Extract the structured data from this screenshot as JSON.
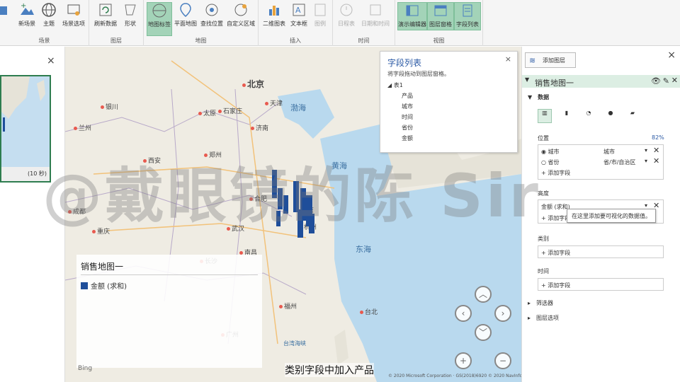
{
  "ribbon": {
    "groups": [
      {
        "label": "场景"
      },
      {
        "label": "图层"
      },
      {
        "label": "地图"
      },
      {
        "label": "插入"
      },
      {
        "label": "时间"
      },
      {
        "label": "视图"
      }
    ],
    "buttons": {
      "play": "播放\n演示",
      "new_scene": "新场景",
      "theme": "主题",
      "scene_options": "场景选项",
      "refresh": "刷新数据",
      "shapes": "形状",
      "map_labels": "地图标签",
      "flat_map": "平面地图",
      "find_location": "查找位置",
      "custom_region": "自定义区域",
      "chart_2d": "二维图表",
      "text_box": "文本框",
      "legend": "图例",
      "timeline": "日程表",
      "date_time": "日期和时间",
      "tour_editor": "演示编辑器",
      "layer_pane": "图层窗格",
      "field_list": "字段列表"
    }
  },
  "left_pane": {
    "close": "×",
    "thumb_duration": "(10 秒)"
  },
  "map": {
    "cities": [
      "北京",
      "天津",
      "太原",
      "石家庄",
      "济南",
      "郑州",
      "西安",
      "合肥",
      "成都",
      "重庆",
      "银川",
      "兰州",
      "长沙",
      "南昌",
      "福州",
      "杭州",
      "南京",
      "武汉",
      "台北",
      "广州"
    ],
    "seas": [
      "渤海",
      "黄海",
      "东海",
      "台湾海峡"
    ],
    "watermark": "@戴眼镜的陈 Sir",
    "caption": "类别字段中加入产品",
    "copyright": "© 2020 Microsoft Corporation · GS(2018)6920  © 2020 NavInfo",
    "bing": "Bing"
  },
  "field_list": {
    "title": "字段列表",
    "description": "将字段拖动到图层窗格。",
    "close": "×",
    "table": "表1",
    "fields": [
      "产品",
      "城市",
      "时间",
      "省份",
      "金额"
    ]
  },
  "legend": {
    "title": "销售地图一",
    "entry": "金额 (求和)",
    "swatch_color": "#1f4e9a"
  },
  "right_pane": {
    "close": "×",
    "add_layer": "添加图层",
    "layer_name": "销售地图一",
    "data_label": "数据",
    "location_label": "位置",
    "location_pct": "82%",
    "loc_rows": [
      {
        "field": "城市",
        "type": "城市"
      },
      {
        "field": "省份",
        "type": "省/市/自治区"
      }
    ],
    "add_field": "添加字段",
    "height_label": "高度",
    "height_field": "金额 (求和)",
    "tooltip": "在这里添加要可视化的数据值。",
    "category_label": "类别",
    "time_label": "时间",
    "filter_label": "筛选器",
    "layer_options_label": "图层选项"
  }
}
